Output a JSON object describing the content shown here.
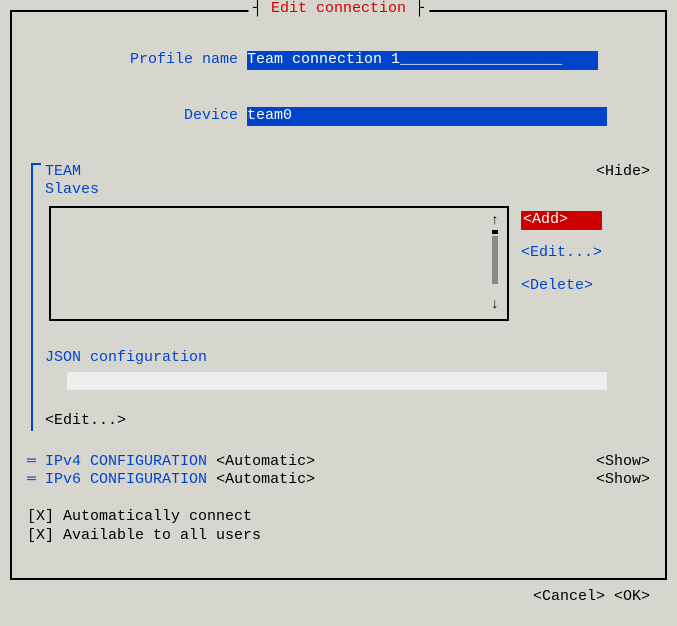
{
  "title_brackets": {
    "open": "┤ ",
    "close": " ├"
  },
  "title": "Edit connection",
  "fields": {
    "profile_label": "Profile name",
    "profile_value": "Team connection 1",
    "profile_pad": "__________________",
    "device_label": "Device",
    "device_value": "team0",
    "device_pad": "                               "
  },
  "team": {
    "heading": "TEAM",
    "hide": "<Hide>",
    "slaves_label": "Slaves",
    "buttons": {
      "add": "<Add>",
      "edit": "<Edit...>",
      "delete": "<Delete>"
    },
    "json_label": "JSON configuration",
    "edit_below": "<Edit...>"
  },
  "ipv4": {
    "label": "IPv4 CONFIGURATION",
    "mode": "<Automatic>",
    "toggle": "<Show>"
  },
  "ipv6": {
    "label": "IPv6 CONFIGURATION",
    "mode": "<Automatic>",
    "toggle": "<Show>"
  },
  "checks": {
    "auto_connect": "[X] Automatically connect",
    "all_users": "[X] Available to all users"
  },
  "dialog": {
    "cancel": "<Cancel>",
    "ok": "<OK>"
  },
  "scroll": {
    "up": "↑",
    "down": "↓"
  }
}
